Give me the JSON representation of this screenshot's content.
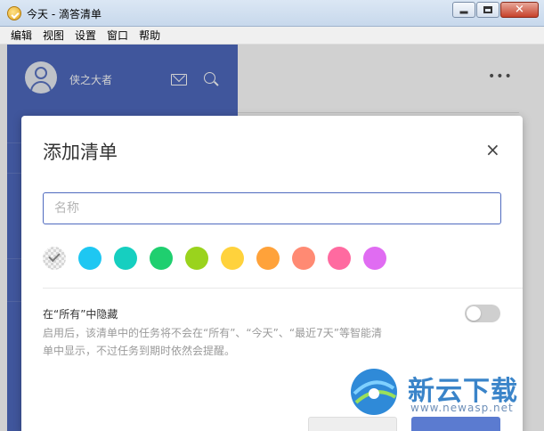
{
  "window": {
    "title": "今天 - 滴答清单"
  },
  "menubar": {
    "items": [
      "编辑",
      "视图",
      "设置",
      "窗口",
      "帮助"
    ]
  },
  "sidebar": {
    "username": "侠之大者"
  },
  "main": {
    "more_label": "•••"
  },
  "dialog": {
    "title": "添加清单",
    "close_label": "×",
    "name_placeholder": "名称",
    "colors": [
      "#1ec7f2",
      "#16cfc0",
      "#1fcf6f",
      "#9ad31d",
      "#ffd23c",
      "#ffa23a",
      "#ff8a73",
      "#ff6aa0",
      "#e06cf2"
    ],
    "hide_title": "在“所有”中隐藏",
    "hide_desc_line1": "启用后，该清单中的任务将不会在“所有”、“今天”、“最近7天”等智能清",
    "hide_desc_line2": "单中显示，不过任务到期时依然会提醒。",
    "hide_toggle_on": false
  },
  "theme": {
    "accent": "#4f6abf"
  },
  "watermark": {
    "brand": "新云下载",
    "url": "www.newasp.net"
  }
}
